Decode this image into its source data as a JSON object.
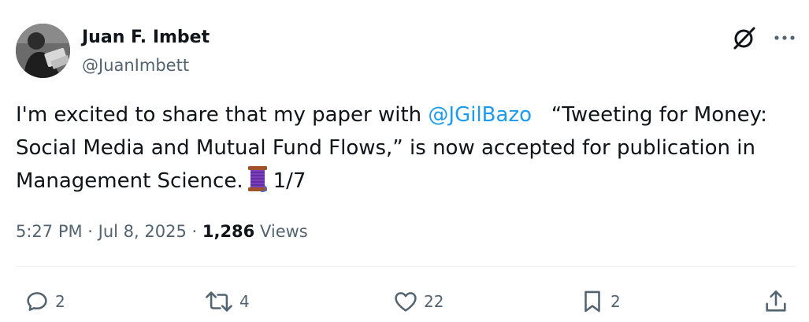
{
  "author": {
    "name": "Juan F. Imbet",
    "handle": "@JuanImbett"
  },
  "tweet": {
    "text_part1": "I'm excited to share that my paper with ",
    "mention": "@JGilBazo",
    "text_part2": "   “Tweeting for Money: Social Media and Mutual Fund Flows,” is now accepted for publication in Management Science.",
    "thread_marker": "1/7",
    "emoji_icon": "spool-of-thread-icon"
  },
  "meta": {
    "time": "5:27 PM",
    "separator1": " · ",
    "date": "Jul 8, 2025",
    "separator2": " · ",
    "views_count": "1,286",
    "views_label": " Views"
  },
  "actions": {
    "replies": "2",
    "reposts": "4",
    "likes": "22",
    "bookmarks": "2"
  },
  "colors": {
    "text": "#0f1419",
    "secondary": "#536471",
    "link": "#1d9bf0",
    "divider": "#eff3f4"
  }
}
